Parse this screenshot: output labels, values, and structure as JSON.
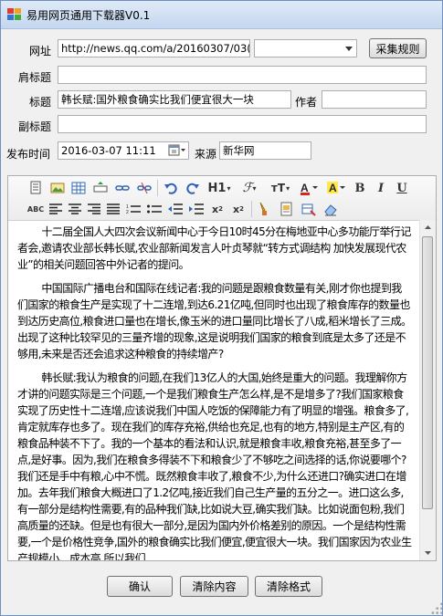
{
  "window": {
    "title": "易用网页通用下载器V0.1",
    "accent_color": "#c4d7ef"
  },
  "form": {
    "url_label": "网址",
    "url_value": "http://news.qq.com/a/20160307/03(",
    "url_combo_value": "",
    "collect_rules_button": "采集规则",
    "shoulder_title_label": "肩标题",
    "shoulder_title_value": "",
    "title_label": "标题",
    "title_value": "韩长赋:国外粮食确实比我们便宜很大一块",
    "author_label": "作者",
    "author_value": "",
    "subtitle_label": "副标题",
    "subtitle_value": "",
    "publish_time_label": "发布时间",
    "publish_time_value": "2016-03-07  11:11",
    "source_label": "来源",
    "source_value": "新华网"
  },
  "toolbar": {
    "row1": [
      "source-icon",
      "insert-image-icon",
      "insert-table-icon",
      "insert-row-icon",
      "link-icon",
      "unlink-icon",
      "undo-icon",
      "redo-icon",
      "heading-icon",
      "font-family-icon",
      "font-size-icon",
      "font-color-icon",
      "highlight-icon",
      "bold-icon",
      "italic-icon",
      "underline-icon"
    ],
    "row2": [
      "spellcheck-icon",
      "align-left-icon",
      "align-center-icon",
      "align-right-icon",
      "justify-icon",
      "ordered-list-icon",
      "unordered-list-icon",
      "outdent-icon",
      "indent-icon",
      "subscript-icon",
      "superscript-icon",
      "format-brush-icon",
      "insert-html-icon",
      "clear-format-icon",
      "eraser-icon"
    ],
    "heading_label": "H1",
    "bold_label": "B",
    "italic_label": "I",
    "underline_label": "U",
    "spell_label": "ABC"
  },
  "content": {
    "paragraphs": [
      "十二届全国人大四次会议新闻中心于今日10时45分在梅地亚中心多功能厅举行记者会,邀请农业部长韩长赋,农业部新闻发言人叶贞琴就“转方式调结构 加快发展现代农业”的相关问题回答中外记者的提问。",
      "中国国际广播电台和国际在线记者:我的问题是跟粮食数量有关,刚才你也提到我们国家的粮食生产是实现了十二连增,到达6.21亿吨,但同时也出现了粮食库存的数量也到达历史高位,粮食进口量也在增长,像玉米的进口量同比增长了八成,稻米增长了三成。出现了这种比较罕见的三量齐增的现象,这是说明我们国家的粮食到底是太多了还是不够用,未来是否还会追求这种粮食的持续增产?",
      "韩长赋:我认为粮食的问题,在我们13亿人的大国,始终是重大的问题。我理解你方才讲的问题实际是三个问题,一个是我们粮食生产怎么样,是不是增多了?我们国家粮食实现了历史性十二连增,应该说我们中国人吃饭的保障能力有了明显的增强。粮食多了,肯定就库存也多了。现在我们的库存充裕,供给也充足,也有的地方,特别是主产区,有的粮食品种装不下了。我的一个基本的看法和认识,就是粮食丰收,粮食充裕,甚至多了一点,是好事。因为,我们在粮食多得装不下和粮食少了不够吃之间选择的话,你说要哪个?我们还是手中有粮,心中不慌。既然粮食丰收了,粮食不少,为什么还进口?确实进口在增加。去年我们粮食大概进口了1.2亿吨,接近我们自己生产量的五分之一。进口这么多,有一部分是结构性需要,有的品种我们缺,比如说大豆,确实我们缺。比如说面包粉,我们高质量的还缺。但是也有很大一部分,是因为国内外价格差别的原因。一个是结构性需要,一个是价格性竞争,国外的粮食确实比我们便宜,便宜很大一块。我们国家因为农业生产规模小、成本高,所以我们"
    ]
  },
  "buttons": {
    "confirm": "确认",
    "clear_content": "清除内容",
    "clear_format": "清除格式"
  }
}
